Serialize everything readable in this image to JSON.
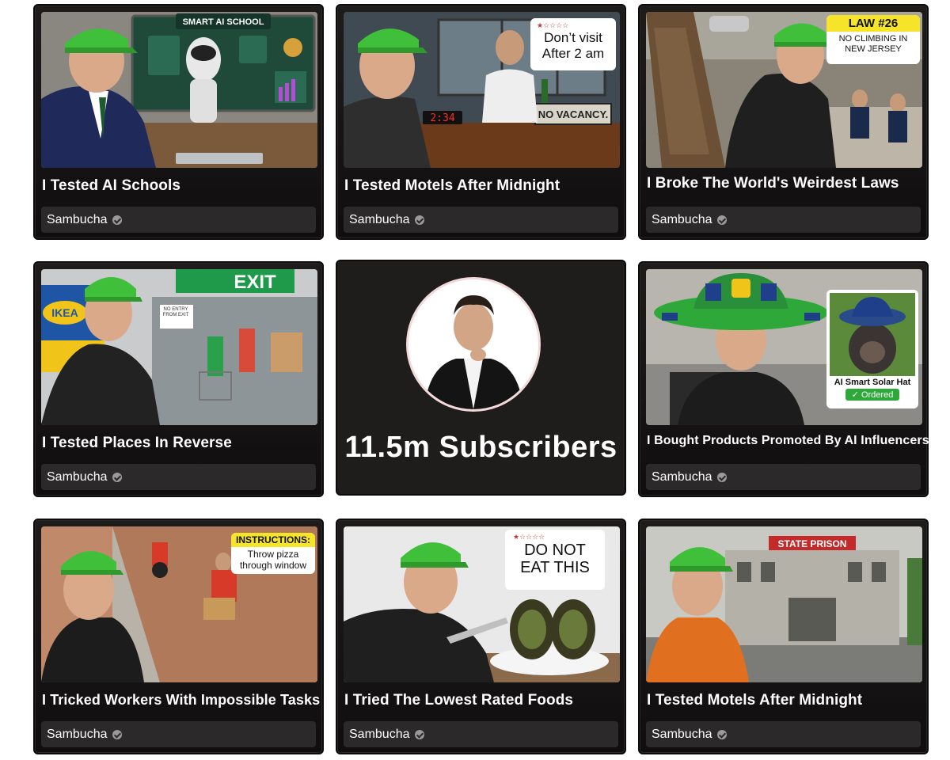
{
  "channel": {
    "name": "Sambucha",
    "subscribers_label": "11.5m Subscribers"
  },
  "videos": [
    {
      "title": "I Tested AI Schools",
      "channel": "Sambucha",
      "overlay": "SMART AI SCHOOL"
    },
    {
      "title": "I Tested Motels After Midnight",
      "channel": "Sambucha",
      "overlay": "Don’t visit After 2 am",
      "overlay_sub": "NO VACANCY.",
      "clock": "2:34"
    },
    {
      "title": "I Broke The World's Weirdest Laws",
      "channel": "Sambucha",
      "overlay": "LAW #26",
      "overlay_sub": "NO CLIMBING IN NEW JERSEY"
    },
    {
      "title": "I Tested Places In Reverse",
      "channel": "Sambucha",
      "overlay": "EXIT",
      "overlay_sub": "NO ENTRY FROM EXIT",
      "brand": "IKEA"
    },
    {
      "title": "I Bought Products Promoted By AI Influencers",
      "channel": "Sambucha",
      "overlay": "AI Smart Solar Hat",
      "overlay_sub": "Ordered"
    },
    {
      "title": "I Tricked Workers With Impossible Tasks",
      "channel": "Sambucha",
      "overlay": "INSTRUCTIONS:",
      "overlay_sub": "Throw pizza through window"
    },
    {
      "title": "I Tried The Lowest Rated Foods",
      "channel": "Sambucha",
      "overlay": "DO NOT EAT THIS"
    },
    {
      "title": "I Tested Motels After Midnight",
      "channel": "Sambucha",
      "overlay": "STATE PRISON"
    }
  ],
  "colors": {
    "card_bg": "#1a1717",
    "channel_bar": "#2b2929",
    "cap_green": "#3fbf3a",
    "page_bg": "#ffffff"
  }
}
